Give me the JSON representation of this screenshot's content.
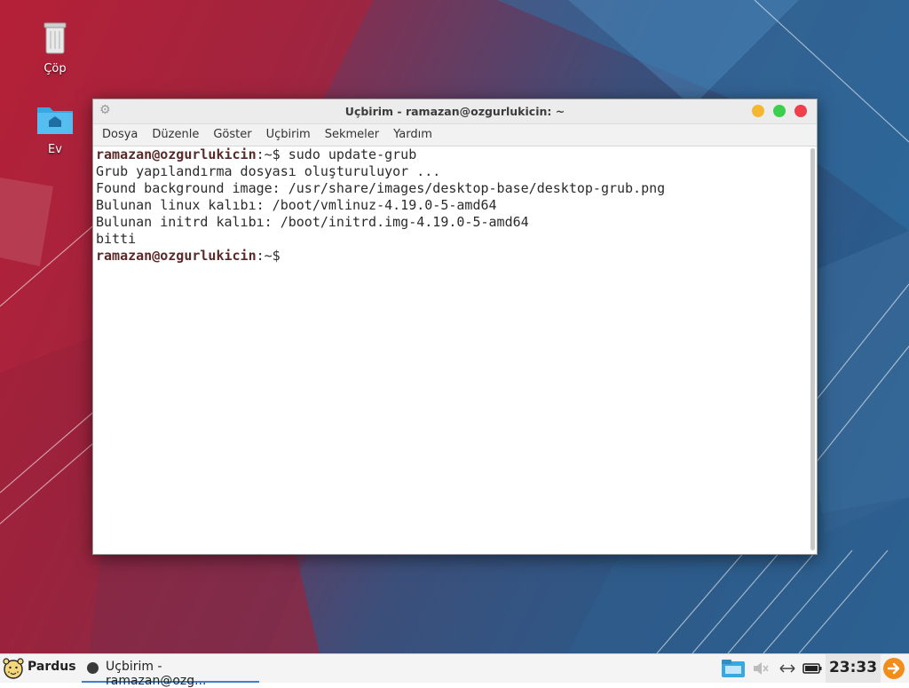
{
  "desktop": {
    "icons": [
      {
        "label": "Çöp",
        "icon": "trash-icon"
      },
      {
        "label": "Ev",
        "icon": "home-folder-icon"
      }
    ]
  },
  "window": {
    "title": "Uçbirim - ramazan@ozgurlukicin: ~",
    "menu": [
      "Dosya",
      "Düzenle",
      "Göster",
      "Uçbirim",
      "Sekmeler",
      "Yardım"
    ],
    "buttons": {
      "minimize_color": "#f5b731",
      "maximize_color": "#3ccf4e",
      "close_color": "#ee3f4a"
    }
  },
  "terminal": {
    "prompt_user": "ramazan@ozgurlukicin",
    "prompt_suffix": ":~$ ",
    "command": "sudo update-grub",
    "output": [
      "Grub yapılandırma dosyası oluşturuluyor ...",
      "Found background image: /usr/share/images/desktop-base/desktop-grub.png",
      "Bulunan linux kalıbı: /boot/vmlinuz-4.19.0-5-amd64",
      "Bulunan initrd kalıbı: /boot/initrd.img-4.19.0-5-amd64",
      "bitti"
    ],
    "final_prompt_user": "ramazan@ozgurlukicin",
    "final_prompt_suffix": ":~$"
  },
  "taskbar": {
    "start_label": "Pardus",
    "task_label": "Uçbirim - ramazan@ozg...",
    "clock": "23:33",
    "tray_icons": [
      "file-manager-icon",
      "volume-muted-icon",
      "network-icon",
      "battery-icon"
    ]
  },
  "colors": {
    "accent": "#3c7fd1",
    "logout": "#f28c1b"
  }
}
